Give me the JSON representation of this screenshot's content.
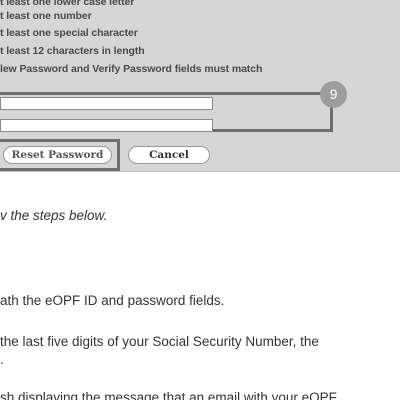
{
  "requirements": [
    "t least one lower case letter",
    "t least one number",
    "t least one special character",
    "t least 12 characters in length",
    "lew Password and Verify Password fields must match"
  ],
  "step_badge": "9",
  "buttons": {
    "reset": "Reset Password",
    "cancel": "Cancel"
  },
  "instructions": {
    "intro": "v the steps below.",
    "line1": "ath the eOPF ID and password fields.",
    "line2": "the last five digits of your Social Security Number, the",
    "line3": ".",
    "line4": "sh displaying the message that an email with your eOPF"
  }
}
